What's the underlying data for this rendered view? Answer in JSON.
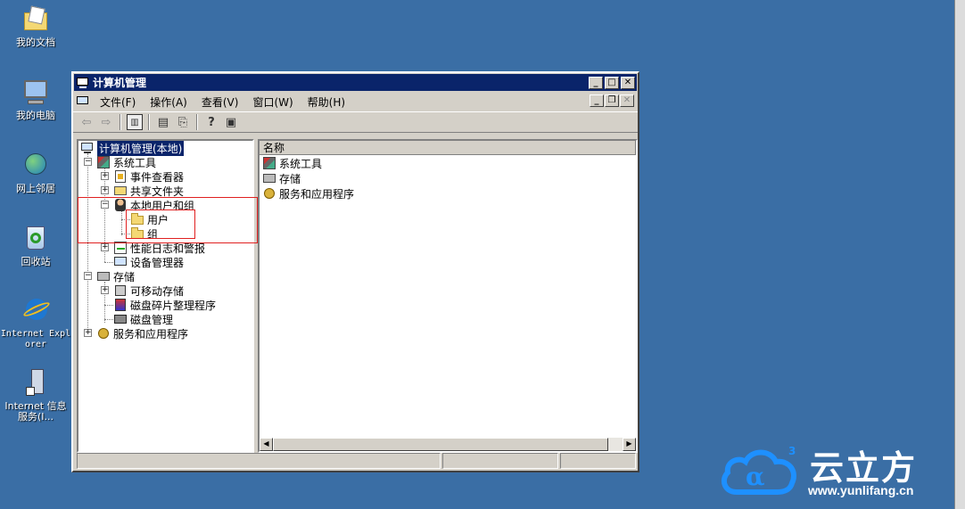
{
  "desktop": {
    "icons": [
      {
        "label": "我的文档"
      },
      {
        "label": "我的电脑"
      },
      {
        "label": "网上邻居"
      },
      {
        "label": "回收站"
      },
      {
        "label": "Internet Explorer"
      },
      {
        "label": "Internet 信息服务(I..."
      }
    ]
  },
  "window": {
    "title": "计算机管理",
    "menu": [
      "文件(F)",
      "操作(A)",
      "查看(V)",
      "窗口(W)",
      "帮助(H)"
    ],
    "tree": {
      "root": "计算机管理(本地)",
      "system_tools": "系统工具",
      "event_viewer": "事件查看器",
      "shared_folders": "共享文件夹",
      "local_users_groups": "本地用户和组",
      "users": "用户",
      "groups": "组",
      "perf_logs": "性能日志和警报",
      "device_manager": "设备管理器",
      "storage": "存储",
      "removable_storage": "可移动存储",
      "defrag": "磁盘碎片整理程序",
      "disk_mgmt": "磁盘管理",
      "services_apps": "服务和应用程序"
    },
    "list": {
      "column_header": "名称",
      "items": [
        "系统工具",
        "存储",
        "服务和应用程序"
      ]
    }
  },
  "logo": {
    "brand": "云立方",
    "url": "www.yunlifang.cn"
  },
  "colors": {
    "desktop": "#3a6ea5",
    "titlebar": "#0a246a",
    "highlight_box": "#e02020"
  }
}
